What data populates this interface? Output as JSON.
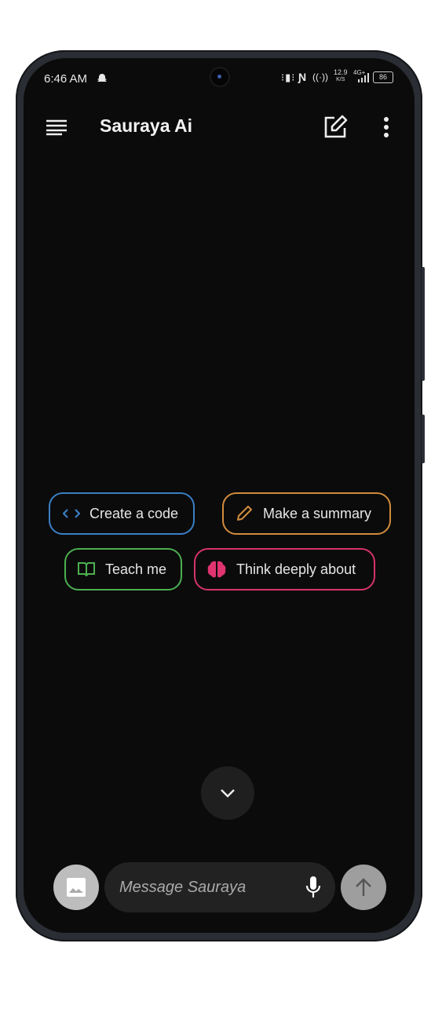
{
  "status_bar": {
    "time": "6:46 AM",
    "net_speed": "12.9",
    "net_unit": "K/S",
    "network": "4G+",
    "battery": "86"
  },
  "header": {
    "title": "Sauraya Ai"
  },
  "suggestions": [
    {
      "label": "Create a code",
      "icon": "code-icon",
      "color": "#3b7fc4"
    },
    {
      "label": "Make a summary",
      "icon": "pencil-icon",
      "color": "#d08c3c"
    },
    {
      "label": "Teach me",
      "icon": "book-icon",
      "color": "#4caf50"
    },
    {
      "label": "Think deeply about",
      "icon": "brain-icon",
      "color": "#e0336f"
    }
  ],
  "composer": {
    "placeholder": "Message Sauraya"
  }
}
